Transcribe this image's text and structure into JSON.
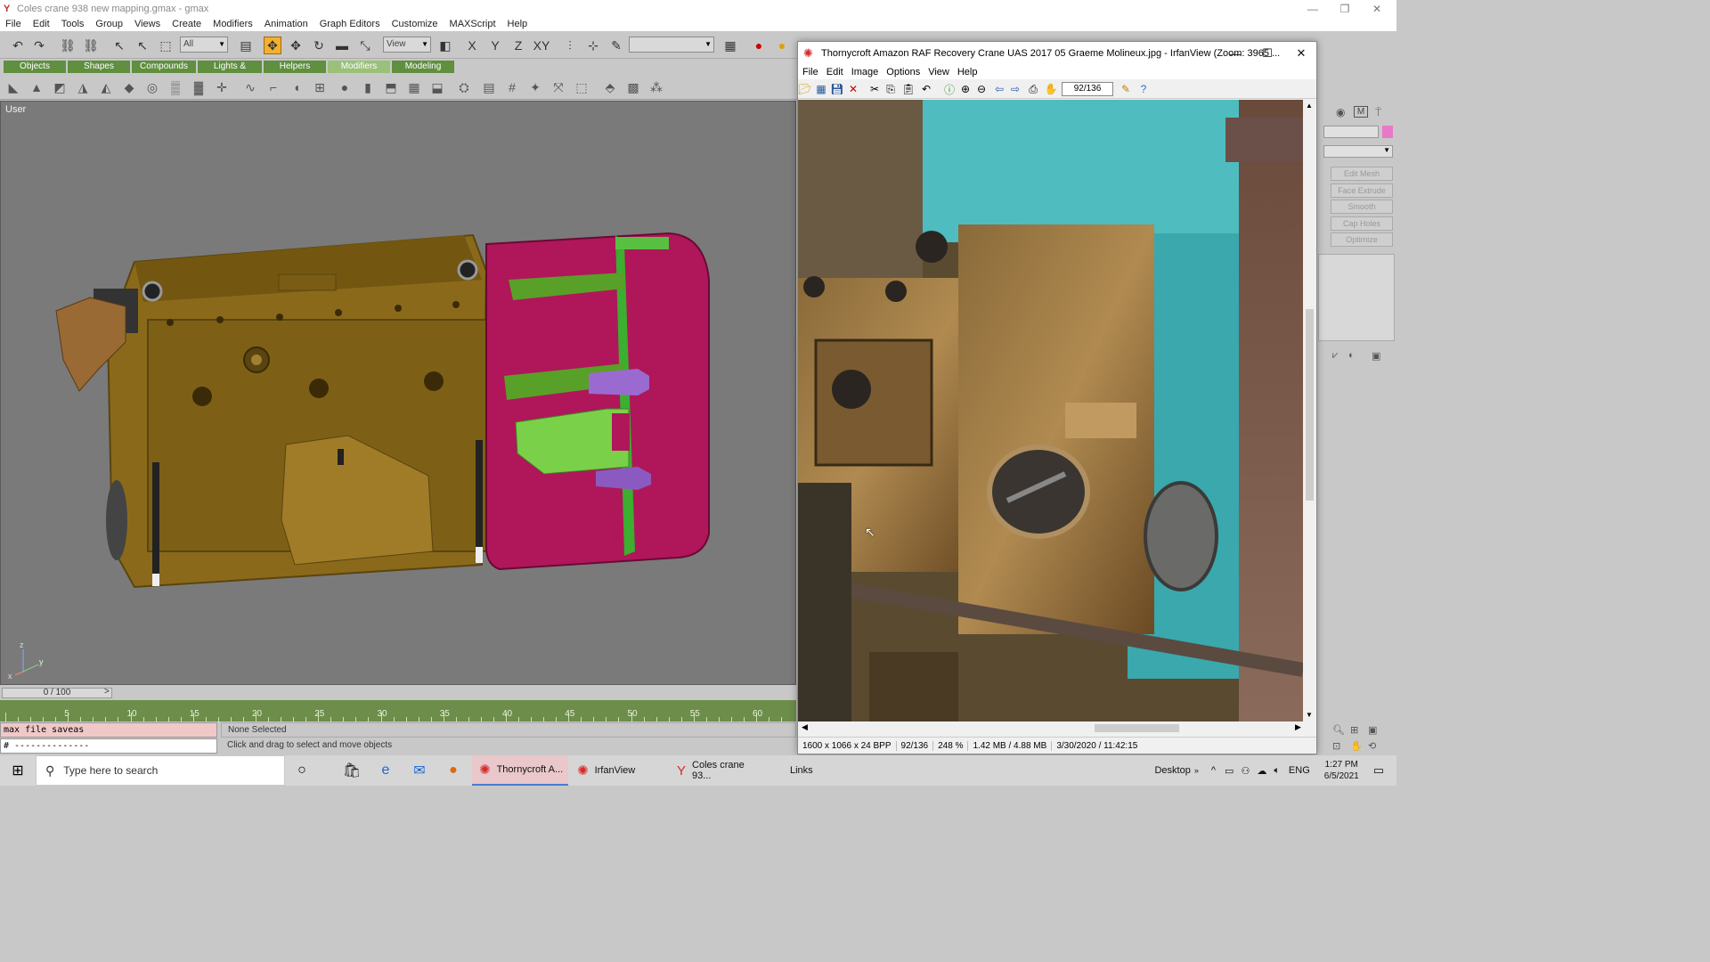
{
  "gmax": {
    "title": "Coles crane 938 new mapping.gmax - gmax",
    "menu": [
      "File",
      "Edit",
      "Tools",
      "Group",
      "Views",
      "Create",
      "Modifiers",
      "Animation",
      "Graph Editors",
      "Customize",
      "MAXScript",
      "Help"
    ],
    "toolbar": {
      "selection_filter": "All",
      "coord_system": "View",
      "named_selection": ""
    },
    "tabs": [
      "Objects",
      "Shapes",
      "Compounds",
      "Lights & Cameras",
      "Helpers",
      "Modifiers",
      "Modeling"
    ],
    "selected_tab": "Modifiers",
    "viewport_label": "User",
    "axis_labels": {
      "z": "z",
      "y": "y",
      "x": "x"
    },
    "time_slider": "0 / 100",
    "track_ticks": [
      "5",
      "10",
      "15",
      "20",
      "25",
      "30",
      "35",
      "40",
      "45",
      "50",
      "55",
      "60"
    ],
    "maxscript_input": "max file saveas",
    "maxscript_output": "# --------------",
    "status_selection": "None Selected",
    "status_prompt": "Click and drag to select and move objects",
    "command_panel_buttons": [
      "Edit Mesh",
      "Face Extrude",
      "Smooth",
      "Cap Holes",
      "Optimize"
    ]
  },
  "irfanview": {
    "title": "Thornycroft Amazon RAF Recovery Crane UAS 2017 05 Graeme Molineux.jpg - IrfanView (Zoom: 3965 ...",
    "menu": [
      "File",
      "Edit",
      "Image",
      "Options",
      "View",
      "Help"
    ],
    "page_counter": "92/136",
    "status": {
      "dimensions": "1600 x 1066 x 24 BPP",
      "index": "92/136",
      "zoom": "248 %",
      "size": "1.42 MB / 4.88 MB",
      "date": "3/30/2020 / 11:42:15"
    }
  },
  "taskbar": {
    "search_placeholder": "Type here to search",
    "apps": [
      {
        "label": "Thornycroft A...",
        "icon": "irfanview-icon"
      },
      {
        "label": "IrfanView",
        "icon": "irfanview-icon"
      },
      {
        "label": "Coles crane 93...",
        "icon": "gmax-icon"
      }
    ],
    "links_label": "Links",
    "desktop_label": "Desktop",
    "language": "ENG",
    "time": "1:27 PM",
    "date": "6/5/2021"
  },
  "colors": {
    "engine_body": "#8a6a1a",
    "engine_magenta": "#b0165a",
    "engine_green": "#78d048",
    "engine_purple": "#9a6ad0",
    "viewport_bg": "#7a7a7a",
    "track_bar": "#6d8d4b",
    "active_tool": "#f2b030"
  }
}
